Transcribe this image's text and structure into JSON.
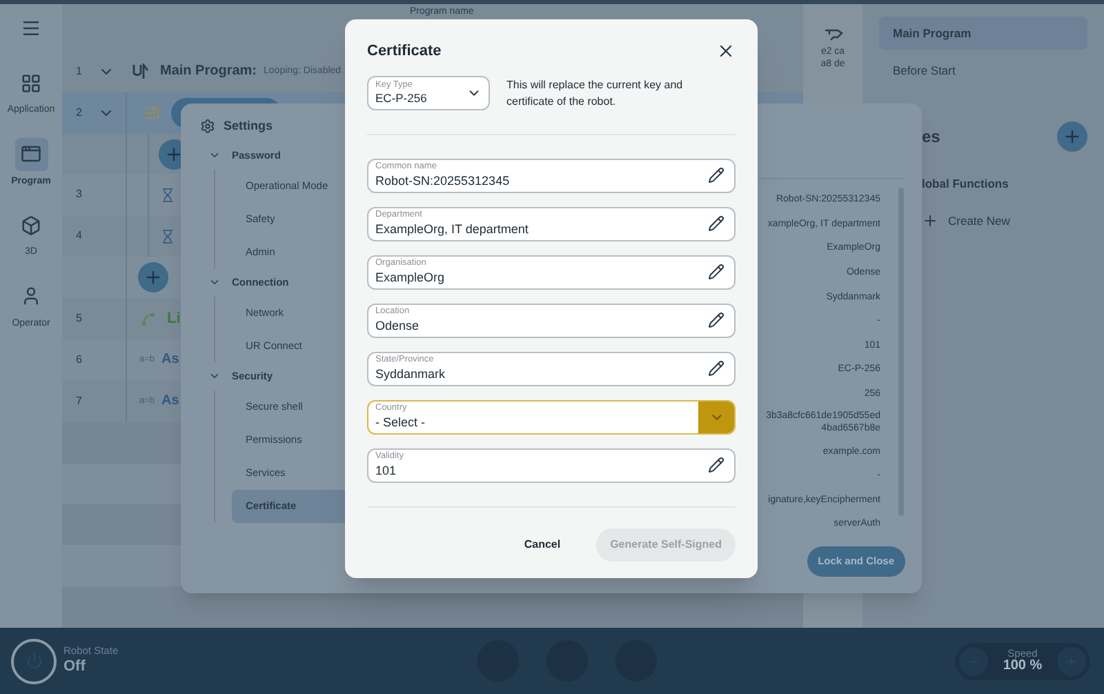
{
  "sidebar": {
    "items": [
      {
        "label": "Application",
        "selected": false
      },
      {
        "label": "Program",
        "selected": true
      },
      {
        "label": "3D",
        "selected": false
      },
      {
        "label": "Operator",
        "selected": false
      }
    ]
  },
  "program": {
    "name_label": "Program name",
    "rows": [
      {
        "number": "1",
        "kind": "main",
        "expanded": true,
        "selected": false,
        "title": "Main Program:",
        "detail": "Looping: Disabled"
      },
      {
        "number": "2",
        "kind": "folder",
        "expanded": true,
        "selected": true
      },
      {
        "kind": "add",
        "selected": false
      },
      {
        "number": "3",
        "kind": "wait",
        "selected": false
      },
      {
        "number": "4",
        "kind": "wait",
        "selected": false
      },
      {
        "kind": "add-outer",
        "selected": false
      },
      {
        "number": "5",
        "kind": "move",
        "selected": false,
        "text": "Li"
      },
      {
        "number": "6",
        "kind": "assign",
        "selected": false,
        "icon_text": "a=b",
        "text": "As"
      },
      {
        "number": "7",
        "kind": "assign",
        "selected": false,
        "icon_text": "a=b",
        "text": "As"
      }
    ]
  },
  "tool_column": {
    "lines": [
      "e2 ca",
      "a8 de"
    ]
  },
  "right_panel": {
    "items": [
      {
        "label": "Main Program",
        "selected": true
      },
      {
        "label": "Before Start",
        "selected": false
      }
    ],
    "section_title": "es",
    "group_title": "lobal Functions",
    "create_label": "Create New"
  },
  "settings": {
    "title": "Settings",
    "nav": [
      {
        "label": "Password",
        "expanded": true,
        "children": [
          {
            "label": "Operational Mode",
            "selected": false
          },
          {
            "label": "Safety",
            "selected": false
          },
          {
            "label": "Admin",
            "selected": false
          }
        ]
      },
      {
        "label": "Connection",
        "expanded": true,
        "children": [
          {
            "label": "Network",
            "selected": false
          },
          {
            "label": "UR Connect",
            "selected": false
          }
        ]
      },
      {
        "label": "Security",
        "expanded": true,
        "children": [
          {
            "label": "Secure shell",
            "selected": false
          },
          {
            "label": "Permissions",
            "selected": false
          },
          {
            "label": "Services",
            "selected": false
          },
          {
            "label": "Certificate",
            "selected": true
          }
        ]
      }
    ],
    "values": [
      {
        "lines": [
          "Robot-SN:20255312345"
        ]
      },
      {
        "lines": [
          "xampleOrg, IT department"
        ]
      },
      {
        "lines": [
          "ExampleOrg"
        ]
      },
      {
        "lines": [
          "Odense"
        ]
      },
      {
        "lines": [
          "Syddanmark"
        ]
      },
      {
        "lines": [
          "-"
        ]
      },
      {
        "lines": [
          "101"
        ]
      },
      {
        "lines": [
          "EC-P-256"
        ]
      },
      {
        "lines": [
          "256"
        ]
      },
      {
        "lines": [
          "3b3a8cfc661de1905d55ed",
          "4bad6567b8e"
        ]
      },
      {
        "lines": [
          "example.com"
        ]
      },
      {
        "lines": [
          "-"
        ]
      },
      {
        "lines": [
          "ignature,keyEncipherment"
        ]
      },
      {
        "lines": [
          "serverAuth"
        ]
      }
    ],
    "lock_button": "Lock and Close"
  },
  "certificate": {
    "title": "Certificate",
    "key_type": {
      "label": "Key Type",
      "value": "EC-P-256"
    },
    "notice": "This will replace the current key and certificate of the robot.",
    "fields": [
      {
        "kind": "text",
        "label": "Common name",
        "value": "Robot-SN:20255312345",
        "focused": false
      },
      {
        "kind": "text",
        "label": "Department",
        "value": "ExampleOrg, IT department",
        "focused": false
      },
      {
        "kind": "text",
        "label": "Organisation",
        "value": "ExampleOrg",
        "focused": false
      },
      {
        "kind": "text",
        "label": "Location",
        "value": "Odense",
        "focused": false
      },
      {
        "kind": "text",
        "label": "State/Province",
        "value": "Syddanmark",
        "focused": false
      },
      {
        "kind": "select",
        "label": "Country",
        "value": "- Select -",
        "focused": true
      },
      {
        "kind": "text",
        "label": "Validity",
        "value": "101",
        "focused": false
      }
    ],
    "buttons": [
      {
        "kind": "text",
        "label": "Cancel",
        "disabled": false
      },
      {
        "kind": "primary",
        "label": "Generate Self-Signed",
        "disabled": true
      }
    ]
  },
  "status_bar": {
    "robot_state_label": "Robot State",
    "robot_state": "Off",
    "speed_label": "Speed",
    "speed": "100 %"
  }
}
